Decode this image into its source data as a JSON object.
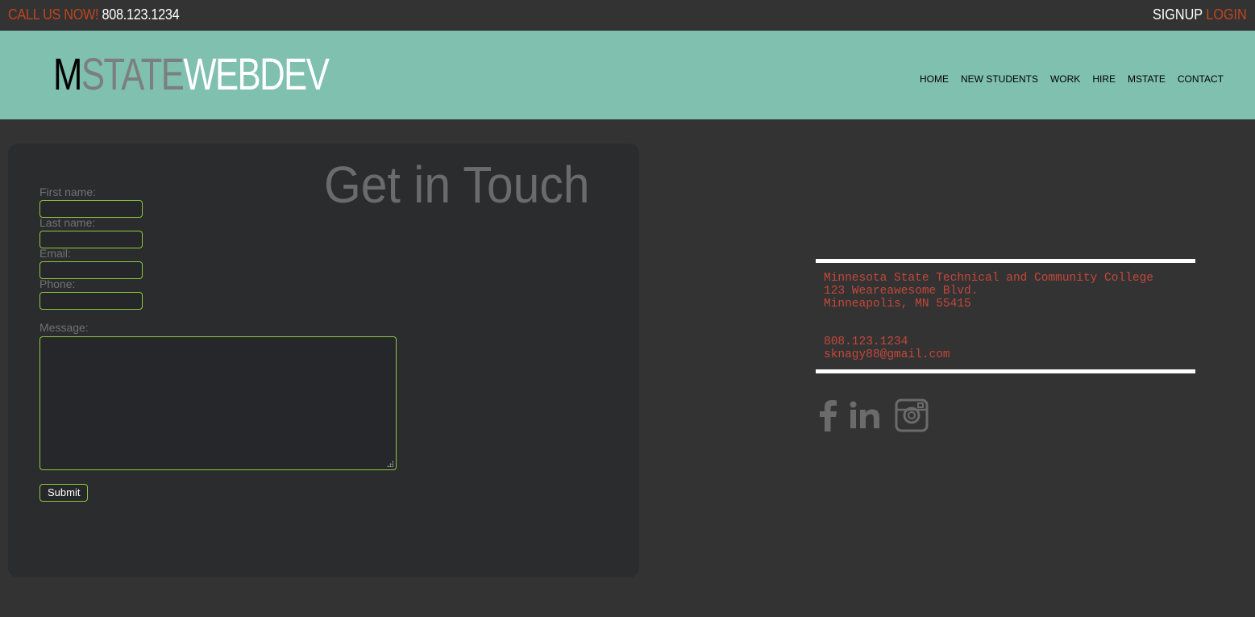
{
  "topbar": {
    "call_label": "CALL US NOW!",
    "phone": "808.123.1234",
    "signup": "SIGNUP",
    "login": "LOGIN"
  },
  "header": {
    "logo": {
      "m": "M",
      "state": "STATE",
      "webdev": "WEBDEV"
    },
    "nav": [
      "HOME",
      "NEW STUDENTS",
      "WORK",
      "HIRE",
      "MSTATE",
      "CONTACT"
    ]
  },
  "form": {
    "title": "Get in Touch",
    "first_name_label": "First name:",
    "last_name_label": "Last name:",
    "email_label": "Email:",
    "phone_label": "Phone:",
    "message_label": "Message:",
    "submit_label": "Submit",
    "first_name_value": "",
    "last_name_value": "",
    "email_value": "",
    "phone_value": "",
    "message_value": ""
  },
  "contact": {
    "address_line1": "Minnesota State Technical and Community College",
    "address_line2": "123 Weareawesome Blvd.",
    "address_line3": "Minneapolis, MN 55415",
    "phone": "808.123.1234",
    "email": "sknagy88@gmail.com"
  },
  "social": {
    "icons": [
      "facebook-icon",
      "linkedin-icon",
      "instagram-icon"
    ]
  },
  "colors": {
    "background": "#333333",
    "header": "#80c0ae",
    "accent_orange": "#c0451e",
    "input_border": "#8ec63f",
    "contact_text": "#c4473a",
    "icon_gray": "#6b6b6b"
  }
}
